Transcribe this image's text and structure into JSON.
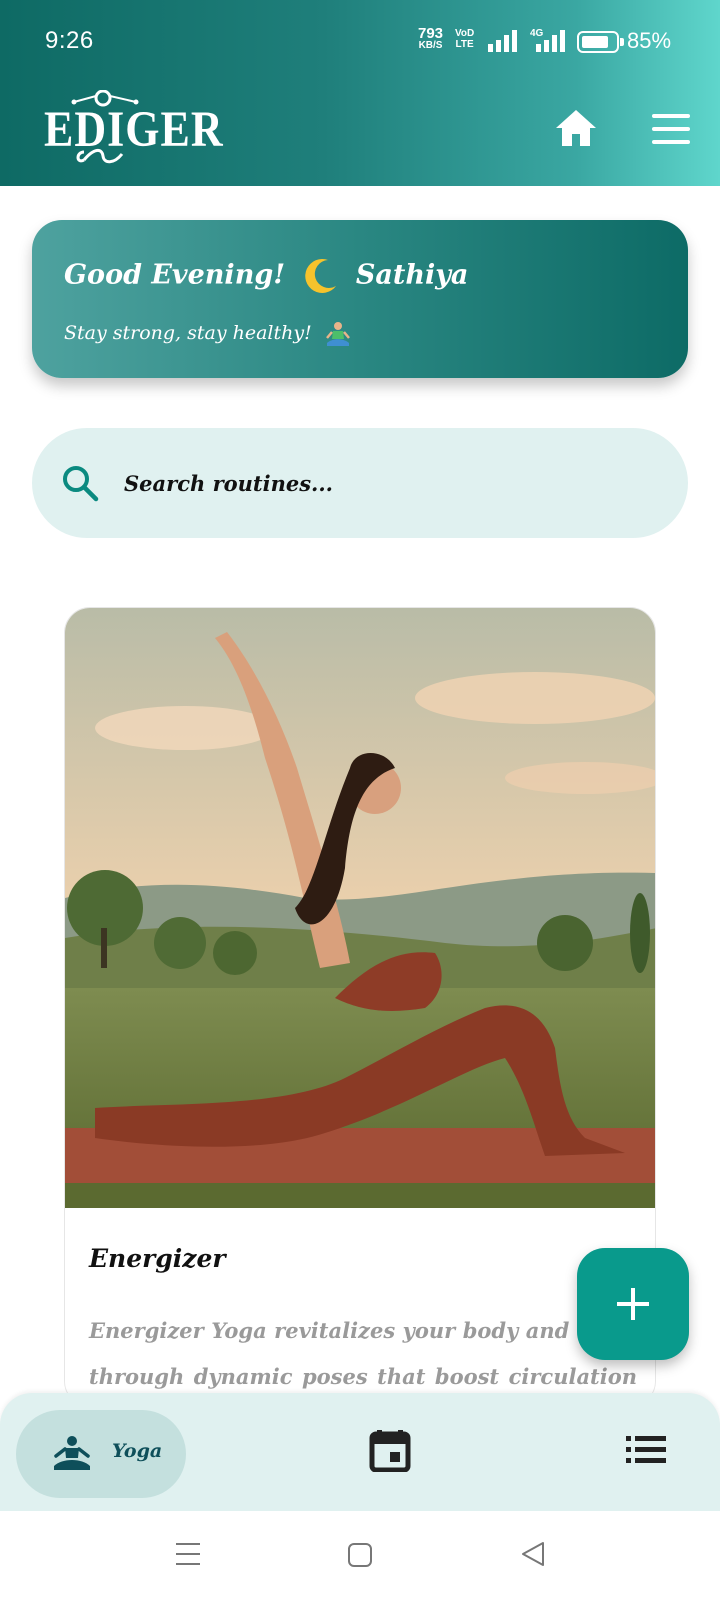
{
  "status_bar": {
    "time": "9:26",
    "net_speed_value": "793",
    "net_speed_unit": "KB/S",
    "volte_line1": "Vo̱",
    "volte_line2": "LTE",
    "network_type": "4G",
    "battery_percent": "85%",
    "battery_level": 0.85
  },
  "header": {
    "logo_text": "EDIGER"
  },
  "greeting": {
    "title_prefix": "Good Evening!",
    "name": "Sathiya",
    "subtitle": "Stay strong, stay healthy!"
  },
  "search": {
    "placeholder": "Search routines..."
  },
  "routine": {
    "title": "Energizer",
    "description": "Energizer Yoga revitalizes your body and mind through dynamic poses that boost circulation and"
  },
  "bottom_nav": {
    "yoga_label": "Yoga"
  },
  "colors": {
    "header_start": "#0e6a64",
    "header_end": "#5fd6cc",
    "accent": "#099a8c",
    "search_bg": "#e0f1f0",
    "nav_bg": "#e0f1f0"
  }
}
